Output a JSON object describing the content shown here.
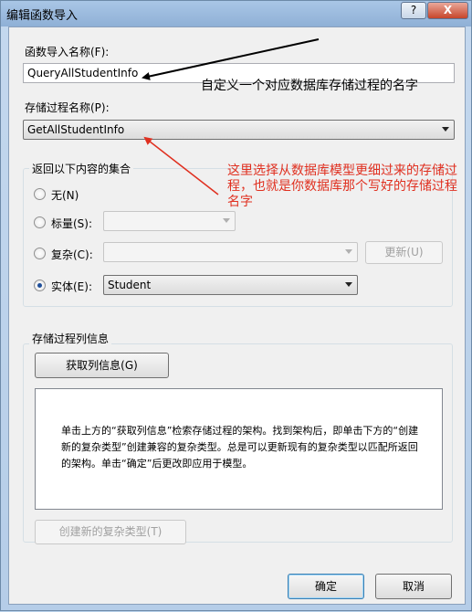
{
  "window": {
    "title": "编辑函数导入",
    "title_ghost": "",
    "help_label": "?",
    "close_label": "X"
  },
  "function_import": {
    "label": "函数导入名称(F):",
    "value": "QueryAllStudentInfo"
  },
  "stored_procedure": {
    "label": "存储过程名称(P):",
    "value": "GetAllStudentInfo"
  },
  "return_group": {
    "title": "返回以下内容的集合",
    "none_label": "无(N)",
    "scalar_label": "标量(S):",
    "scalar_value": "",
    "complex_label": "复杂(C):",
    "complex_value": "",
    "update_label": "更新(U)",
    "entity_label": "实体(E):",
    "entity_value": "Student",
    "selected": "entity"
  },
  "column_group": {
    "title": "存储过程列信息",
    "get_columns_label": "获取列信息(G)",
    "info_text": "单击上方的“获取列信息”检索存储过程的架构。找到架构后，即单击下方的“创建新的复杂类型”创建兼容的复杂类型。总是可以更新现有的复杂类型以匹配所返回的架构。单击“确定”后更改即应用于模型。",
    "create_complex_label": "创建新的复杂类型(T)"
  },
  "footer": {
    "ok_label": "确定",
    "cancel_label": "取消"
  },
  "annotations": {
    "note1": "自定义一个对应数据库存储过程的名字",
    "note2": "这里选择从数据库模型更细过来的存储过程，也就是你数据库那个写好的存储过程名字",
    "note1_color": "#1a1a1a",
    "note2_color": "#e03020"
  }
}
